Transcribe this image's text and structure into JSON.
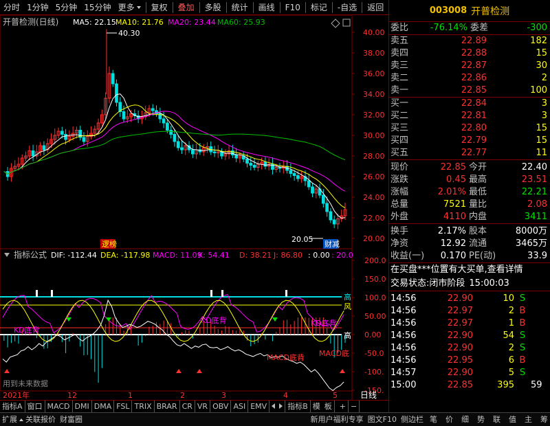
{
  "toolbar": {
    "items": [
      "分时",
      "1分钟",
      "5分钟",
      "15分钟",
      "更多",
      "复权",
      "叠加",
      "多股",
      "统计",
      "画线",
      "F10",
      "标记",
      "-自选",
      "返回"
    ]
  },
  "stock": {
    "code": "003008",
    "name": "开普检测"
  },
  "kline": {
    "title": "开普检测(日线)",
    "ma5": "MA5: 22.15",
    "ma10": "MA10: 21.76",
    "ma20": "MA20: 23.44",
    "ma60": "MA60: 25.93",
    "high_mark": "40.30",
    "low_mark": "20.05",
    "tag_left": "逻榜",
    "tag_right": "财减",
    "yticks": [
      "40.00",
      "38.00",
      "36.00",
      "34.00",
      "32.00",
      "30.00",
      "28.00",
      "26.00",
      "24.00",
      "22.00",
      "20.00"
    ]
  },
  "indicator": {
    "name": "指标公式",
    "dif": "DIF: -112.44",
    "dea": "DEA: -117.98",
    "macd": "MACD: 11.09",
    "k": "K: 54.41",
    "d": "D: 38.21",
    "j": "J: 86.80",
    "v0": ": 0.00",
    "v1": ": 20.0",
    "yticks": [
      "200.0",
      "150.0",
      "100.0",
      "50.00",
      "0.00",
      "-50.0",
      "-100.",
      "-150.",
      "-200."
    ],
    "line_hi": "高",
    "line_mid": "风",
    "line_lo": "高",
    "labels": [
      "KD底背",
      "KD底背",
      "KD底背",
      "MACD底背",
      "MACD底"
    ],
    "bottom_note": "用到未来数据"
  },
  "dates": [
    "2021年",
    "12",
    "1",
    "2",
    "3",
    "4",
    "5"
  ],
  "date_period": "日线",
  "tabs": [
    "指标A",
    "窗口",
    "MACD",
    "DMI",
    "DMA",
    "FSL",
    "TRIX",
    "BRAR",
    "CR",
    "VR",
    "OBV",
    "ASI",
    "EMV",
    "指标B",
    "模",
    "板"
  ],
  "quote": {
    "weibi_label": "委比",
    "weibi": "-76.14%",
    "weicha_label": "委差",
    "weicha": "-300",
    "asks": [
      {
        "label": "卖五",
        "price": "22.89",
        "vol": "182"
      },
      {
        "label": "卖四",
        "price": "22.88",
        "vol": "15"
      },
      {
        "label": "卖三",
        "price": "22.87",
        "vol": "30"
      },
      {
        "label": "卖二",
        "price": "22.86",
        "vol": "2"
      },
      {
        "label": "卖一",
        "price": "22.85",
        "vol": "100"
      }
    ],
    "bids": [
      {
        "label": "买一",
        "price": "22.84",
        "vol": "3"
      },
      {
        "label": "买二",
        "price": "22.81",
        "vol": "3"
      },
      {
        "label": "买三",
        "price": "22.80",
        "vol": "15"
      },
      {
        "label": "买四",
        "price": "22.79",
        "vol": "15"
      },
      {
        "label": "买五",
        "price": "22.77",
        "vol": "11"
      }
    ],
    "stats": [
      {
        "l1": "现价",
        "v1": "22.85",
        "c1": "r",
        "l2": "今开",
        "v2": "22.40",
        "c2": "w"
      },
      {
        "l1": "涨跌",
        "v1": "0.45",
        "c1": "r",
        "l2": "最高",
        "v2": "23.51",
        "c2": "r"
      },
      {
        "l1": "涨幅",
        "v1": "2.01%",
        "c1": "r",
        "l2": "最低",
        "v2": "22.21",
        "c2": "g"
      },
      {
        "l1": "总量",
        "v1": "7521",
        "c1": "y",
        "l2": "量比",
        "v2": "2.08",
        "c2": "r"
      },
      {
        "l1": "外盘",
        "v1": "4110",
        "c1": "r",
        "l2": "内盘",
        "v2": "3411",
        "c2": "g"
      }
    ],
    "fund": [
      {
        "l1": "换手",
        "v1": "2.17%",
        "l2": "股本",
        "v2": "8000万"
      },
      {
        "l1": "净资",
        "v1": "12.92",
        "l2": "流通",
        "v2": "3465万"
      },
      {
        "l1": "收益(一)",
        "v1": "0.170",
        "l2": "PE(动)",
        "v2": "33.9"
      }
    ],
    "notice": "在买盘***位置有大买单,查看详情",
    "trade_status_label": "交易状态:",
    "trade_status": "闭市阶段",
    "trade_time": "15:00:03",
    "ticks": [
      {
        "t": "14:56",
        "p": "22.90",
        "v": "10",
        "s": "S"
      },
      {
        "t": "14:56",
        "p": "22.97",
        "v": "2",
        "s": "B"
      },
      {
        "t": "14:56",
        "p": "22.97",
        "v": "1",
        "s": "B"
      },
      {
        "t": "14:56",
        "p": "22.90",
        "v": "54",
        "s": "S"
      },
      {
        "t": "14:56",
        "p": "22.90",
        "v": "2",
        "s": "S"
      },
      {
        "t": "14:56",
        "p": "22.95",
        "v": "6",
        "s": "B"
      },
      {
        "t": "14:57",
        "p": "22.90",
        "v": "5",
        "s": "S"
      },
      {
        "t": "15:00",
        "p": "22.85",
        "v": "395",
        "s": ""
      }
    ],
    "extra_count": "59"
  },
  "statusbar": {
    "left": [
      "扩展",
      "关联报价",
      "财富圈"
    ],
    "mid": [
      "新用户福利专享",
      "图文F10",
      "侧边栏"
    ],
    "right": [
      "笔",
      "价",
      "细",
      "势",
      "联",
      "值",
      "主",
      "筹"
    ]
  },
  "colors": {
    "up": "#ff3030",
    "down": "#00e0e0",
    "ma5": "#ffffff",
    "ma10": "#ffff00",
    "ma20": "#ff00ff",
    "ma60": "#00c000"
  }
}
